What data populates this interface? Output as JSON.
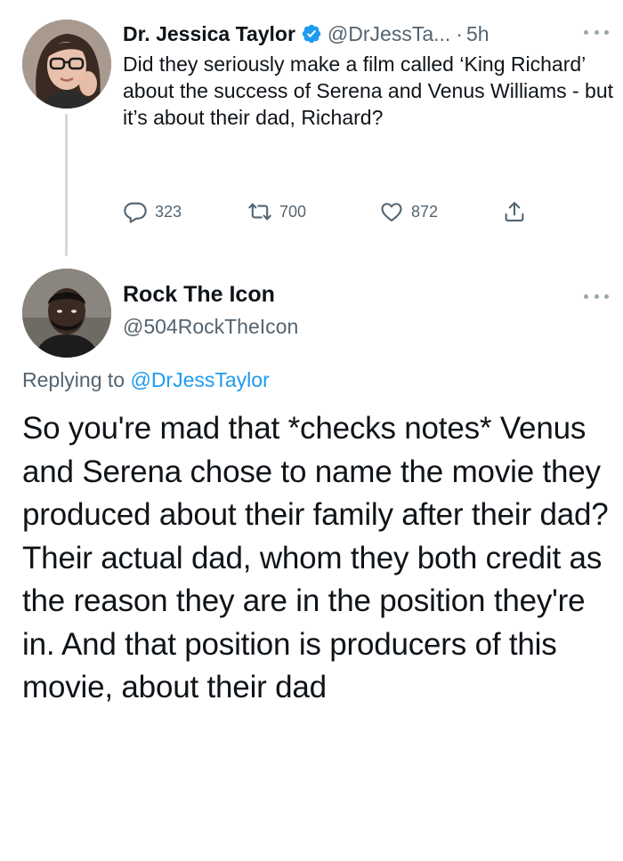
{
  "original_tweet": {
    "author_name": "Dr. Jessica Taylor",
    "handle": "@DrJessTa...",
    "separator": "·",
    "time": "5h",
    "text": "Did they seriously make a film called ‘King Richard’ about the success of Serena and Venus Williams - but it’s about their dad, Richard?",
    "stats": {
      "replies": "323",
      "retweets": "700",
      "likes": "872"
    }
  },
  "reply_tweet": {
    "author_name": "Rock The Icon",
    "handle": "@504RockTheIcon",
    "replying_prefix": "Replying to ",
    "replying_to": "@DrJessTaylor",
    "text": "So you're mad that *checks notes* Venus and Serena chose to name the movie they produced about their family after their dad? Their actual dad, whom they both credit as the reason they are in the position they're in. And that position is producers of this movie, about their dad"
  },
  "colors": {
    "text_primary": "#0f1419",
    "text_secondary": "#536471",
    "link_blue": "#1d9bf0",
    "verified_blue": "#1d9bf0",
    "thread_line": "#cfd9de"
  },
  "icons": [
    "verified-badge-icon",
    "more-icon",
    "reply-icon",
    "retweet-icon",
    "like-icon",
    "share-icon"
  ]
}
